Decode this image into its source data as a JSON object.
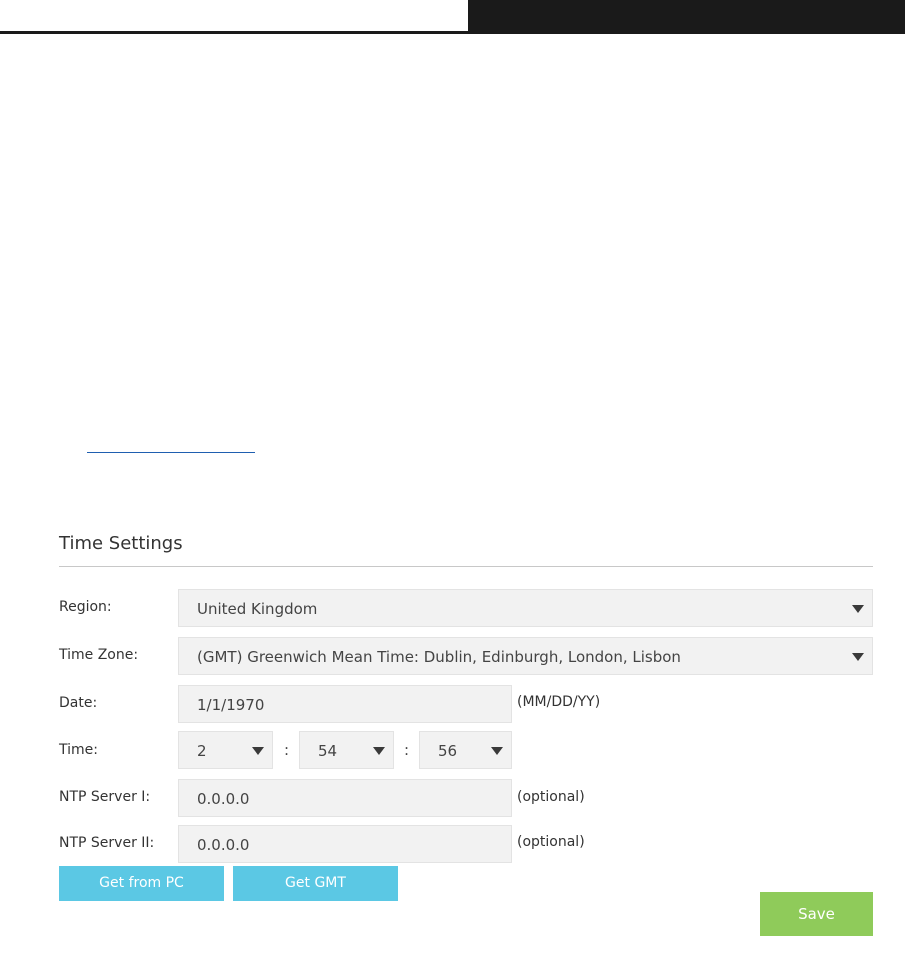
{
  "section": {
    "title": "Time Settings"
  },
  "form": {
    "region": {
      "label": "Region:",
      "value": "United Kingdom"
    },
    "time_zone": {
      "label": "Time Zone:",
      "value": "(GMT) Greenwich Mean Time: Dublin, Edinburgh, London, Lisbon"
    },
    "date": {
      "label": "Date:",
      "value": "1/1/1970",
      "hint": "(MM/DD/YY)"
    },
    "time": {
      "label": "Time:",
      "hour": "2",
      "minute": "54",
      "second": "56",
      "separator": ":"
    },
    "ntp1": {
      "label": "NTP Server I:",
      "value": "0.0.0.0",
      "hint": "(optional)"
    },
    "ntp2": {
      "label": "NTP Server II:",
      "value": "0.0.0.0",
      "hint": "(optional)"
    }
  },
  "buttons": {
    "get_from_pc": "Get from PC",
    "get_gmt": "Get GMT",
    "save": "Save"
  },
  "colors": {
    "header_bar": "#1a1a1a",
    "button_blue": "#5bc8e4",
    "button_green": "#8fcb5a",
    "link": "#1f5fb0"
  },
  "icons": {
    "dropdown": "triangle-down-icon"
  }
}
